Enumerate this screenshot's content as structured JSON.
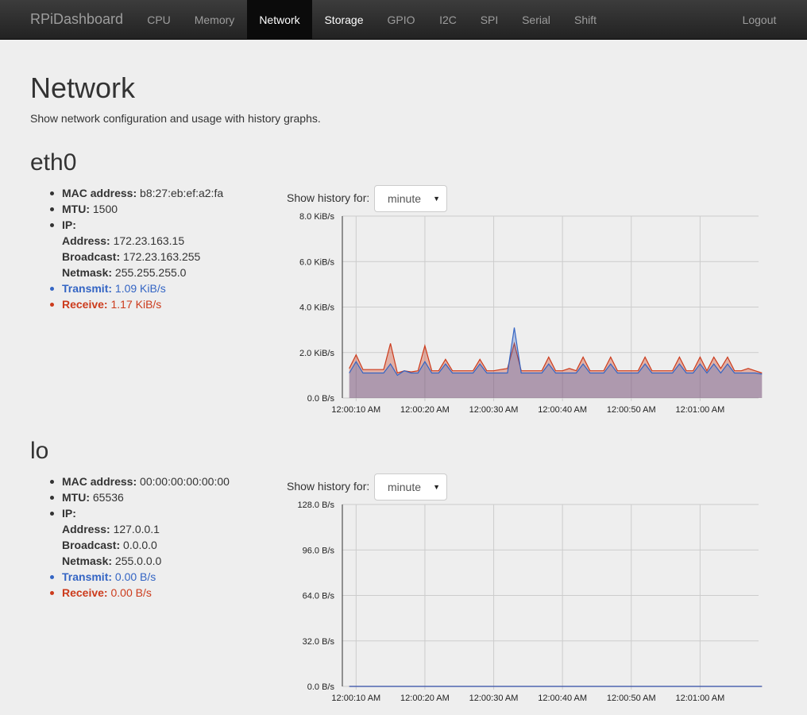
{
  "nav": {
    "brand": "RPiDashboard",
    "items": [
      {
        "label": "CPU"
      },
      {
        "label": "Memory"
      },
      {
        "label": "Network"
      },
      {
        "label": "Storage"
      },
      {
        "label": "GPIO"
      },
      {
        "label": "I2C"
      },
      {
        "label": "SPI"
      },
      {
        "label": "Serial"
      },
      {
        "label": "Shift"
      }
    ],
    "logout": "Logout"
  },
  "page": {
    "title": "Network",
    "subtitle": "Show network configuration and usage with history graphs."
  },
  "labels": {
    "mac": "MAC address:",
    "mtu": "MTU:",
    "ip": "IP:",
    "address": "Address:",
    "broadcast": "Broadcast:",
    "netmask": "Netmask:",
    "transmit": "Transmit:",
    "receive": "Receive:",
    "history": "Show history for:"
  },
  "colors": {
    "transmit": "#3465c4",
    "receive": "#cc3b1c"
  },
  "interfaces": [
    {
      "name": "eth0",
      "mac": "b8:27:eb:ef:a2:fa",
      "mtu": "1500",
      "address": "172.23.163.15",
      "broadcast": "172.23.163.255",
      "netmask": "255.255.255.0",
      "transmit": "1.09 KiB/s",
      "receive": "1.17 KiB/s",
      "history": "minute"
    },
    {
      "name": "lo",
      "mac": "00:00:00:00:00:00",
      "mtu": "65536",
      "address": "127.0.0.1",
      "broadcast": "0.0.0.0",
      "netmask": "255.0.0.0",
      "transmit": "0.00 B/s",
      "receive": "0.00 B/s",
      "history": "minute"
    }
  ],
  "chart_data": [
    {
      "type": "area",
      "ylim": [
        0,
        8
      ],
      "yticks": [
        "0.0 B/s",
        "2.0 KiB/s",
        "4.0 KiB/s",
        "6.0 KiB/s",
        "8.0 KiB/s"
      ],
      "xticks": [
        "12:00:10 AM",
        "12:00:20 AM",
        "12:00:30 AM",
        "12:00:40 AM",
        "12:00:50 AM",
        "12:01:00 AM"
      ],
      "x": [
        9,
        10,
        11,
        12,
        13,
        14,
        15,
        16,
        17,
        18,
        19,
        20,
        21,
        22,
        23,
        24,
        25,
        26,
        27,
        28,
        29,
        30,
        31,
        32,
        33,
        34,
        35,
        36,
        37,
        38,
        39,
        40,
        41,
        42,
        43,
        44,
        45,
        46,
        47,
        48,
        49,
        50,
        51,
        52,
        53,
        54,
        55,
        56,
        57,
        58,
        59,
        60,
        61,
        62,
        63,
        64,
        65,
        66,
        67,
        68,
        69
      ],
      "series": [
        {
          "name": "Receive",
          "values": [
            1.3,
            1.9,
            1.25,
            1.25,
            1.25,
            1.25,
            2.4,
            1.1,
            1.2,
            1.15,
            1.2,
            2.3,
            1.2,
            1.2,
            1.7,
            1.2,
            1.2,
            1.2,
            1.2,
            1.7,
            1.2,
            1.2,
            1.25,
            1.3,
            2.4,
            1.2,
            1.2,
            1.2,
            1.2,
            1.8,
            1.2,
            1.2,
            1.3,
            1.2,
            1.8,
            1.2,
            1.2,
            1.2,
            1.8,
            1.2,
            1.2,
            1.2,
            1.2,
            1.8,
            1.2,
            1.2,
            1.2,
            1.2,
            1.8,
            1.2,
            1.2,
            1.8,
            1.2,
            1.8,
            1.3,
            1.8,
            1.2,
            1.2,
            1.3,
            1.2,
            1.1
          ]
        },
        {
          "name": "Transmit",
          "values": [
            1.1,
            1.6,
            1.1,
            1.1,
            1.1,
            1.1,
            1.5,
            1.0,
            1.2,
            1.1,
            1.1,
            1.6,
            1.1,
            1.1,
            1.5,
            1.1,
            1.1,
            1.1,
            1.1,
            1.5,
            1.1,
            1.1,
            1.1,
            1.1,
            3.1,
            1.1,
            1.1,
            1.1,
            1.1,
            1.5,
            1.1,
            1.1,
            1.1,
            1.1,
            1.5,
            1.1,
            1.1,
            1.1,
            1.5,
            1.1,
            1.1,
            1.1,
            1.1,
            1.5,
            1.1,
            1.1,
            1.1,
            1.1,
            1.5,
            1.1,
            1.1,
            1.5,
            1.1,
            1.5,
            1.1,
            1.5,
            1.1,
            1.1,
            1.1,
            1.1,
            1.05
          ]
        }
      ]
    },
    {
      "type": "area",
      "ylim": [
        0,
        128
      ],
      "yticks": [
        "0.0 B/s",
        "32.0 B/s",
        "64.0 B/s",
        "96.0 B/s",
        "128.0 B/s"
      ],
      "xticks": [
        "12:00:10 AM",
        "12:00:20 AM",
        "12:00:30 AM",
        "12:00:40 AM",
        "12:00:50 AM",
        "12:01:00 AM"
      ],
      "x": [
        9,
        69
      ],
      "series": [
        {
          "name": "Receive",
          "values": [
            0,
            0
          ]
        },
        {
          "name": "Transmit",
          "values": [
            0,
            0
          ]
        }
      ]
    }
  ]
}
